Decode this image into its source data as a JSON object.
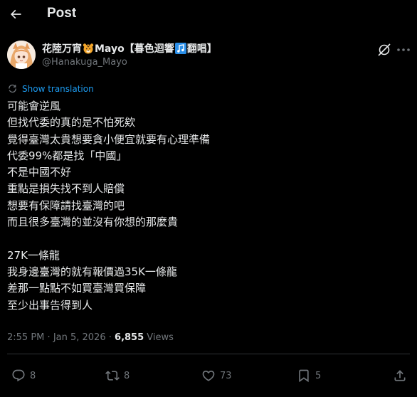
{
  "header": {
    "title": "Post",
    "back_icon": "arrow-left-icon"
  },
  "author": {
    "name_part1": "花陸万宵",
    "name_part2": "Mayo【暮色迴響",
    "name_part3": "翻唱】",
    "handle": "@Hanakuga_Mayo",
    "emoji1": "tiger-face-icon",
    "emoji2": "music-notes-icon"
  },
  "translation": {
    "label": "Show translation"
  },
  "post": {
    "lines": [
      "可能會逆風",
      "但找代委的真的是不怕死欸",
      "覺得臺灣太貴想要貪小便宜就要有心理準備",
      "代委99%都是找「中國」",
      "不是中國不好",
      "重點是損失找不到人賠償",
      "想要有保障請找臺灣的吧",
      "而且很多臺灣的並沒有你想的那麼貴",
      "",
      "27K一條龍",
      "我身邊臺灣的就有報價過35K一條龍",
      "差那一點點不如買臺灣買保障",
      "至少出事告得到人"
    ]
  },
  "meta": {
    "time": "2:55 PM",
    "separator": "·",
    "date": "Jan 5, 2026",
    "views_count": "6,855",
    "views_label": "Views"
  },
  "actions": {
    "replies": "8",
    "reposts": "8",
    "likes": "73",
    "bookmarks": "5"
  },
  "colors": {
    "background": "#000000",
    "text": "#e7e9ea",
    "muted": "#71767b",
    "link": "#1d9bf0",
    "divider": "#2f3336"
  }
}
